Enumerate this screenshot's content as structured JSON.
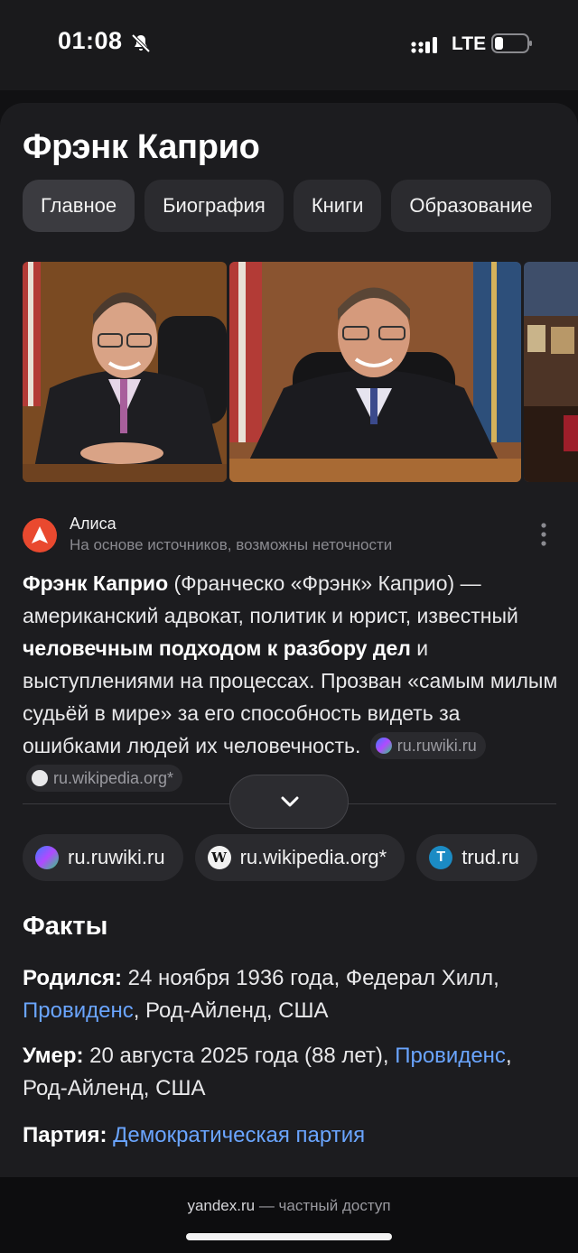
{
  "status": {
    "time": "01:08",
    "network": "LTE"
  },
  "title": "Фрэнк Каприо",
  "tabs": [
    "Главное",
    "Биография",
    "Книги",
    "Образование"
  ],
  "alisa": {
    "name": "Алиса",
    "subtitle": "На основе источников, возможны неточности",
    "answer": {
      "p1_bold": "Фрэнк Каприо",
      "p1": " (Франческо «Фрэнк» Каприо) — американский адвокат, политик и юрист, известный ",
      "p2_bold": "человечным подходом к разбору дел",
      "p2": " и выступлениями на процессах. Прозван «самым милым судьёй в мире» за его способность видеть за ошибками людей их человечность.",
      "chip1": "ru.ruwiki.ru",
      "chip2": "ru.wikipedia.org*"
    }
  },
  "sources": [
    {
      "label": "ru.ruwiki.ru",
      "icon": "ruwiki-icon"
    },
    {
      "label": "ru.wikipedia.org*",
      "icon": "wikipedia-icon"
    },
    {
      "label": "trud.ru",
      "icon": "trud-icon"
    }
  ],
  "facts": {
    "title": "Факты",
    "born_label": "Родился:",
    "born_value": " 24 ноября 1936 года, Федерал Хилл,",
    "born_link": "Провиденс",
    "born_rest": ", Род-Айленд, США",
    "died_label": "Умер:",
    "died_value": " 20 августа 2025 года (88 лет),",
    "died_link": "Провиденс",
    "died_rest": ", Род-Айленд, США",
    "party_label": "Партия:",
    "party_link": "Демократическая партия"
  },
  "footer": {
    "domain": "yandex.ru",
    "suffix": " — частный доступ"
  },
  "colors": {
    "accent_link": "#6aa5ff",
    "alisa": "#e9492f",
    "card_bg": "#1c1c1f"
  }
}
